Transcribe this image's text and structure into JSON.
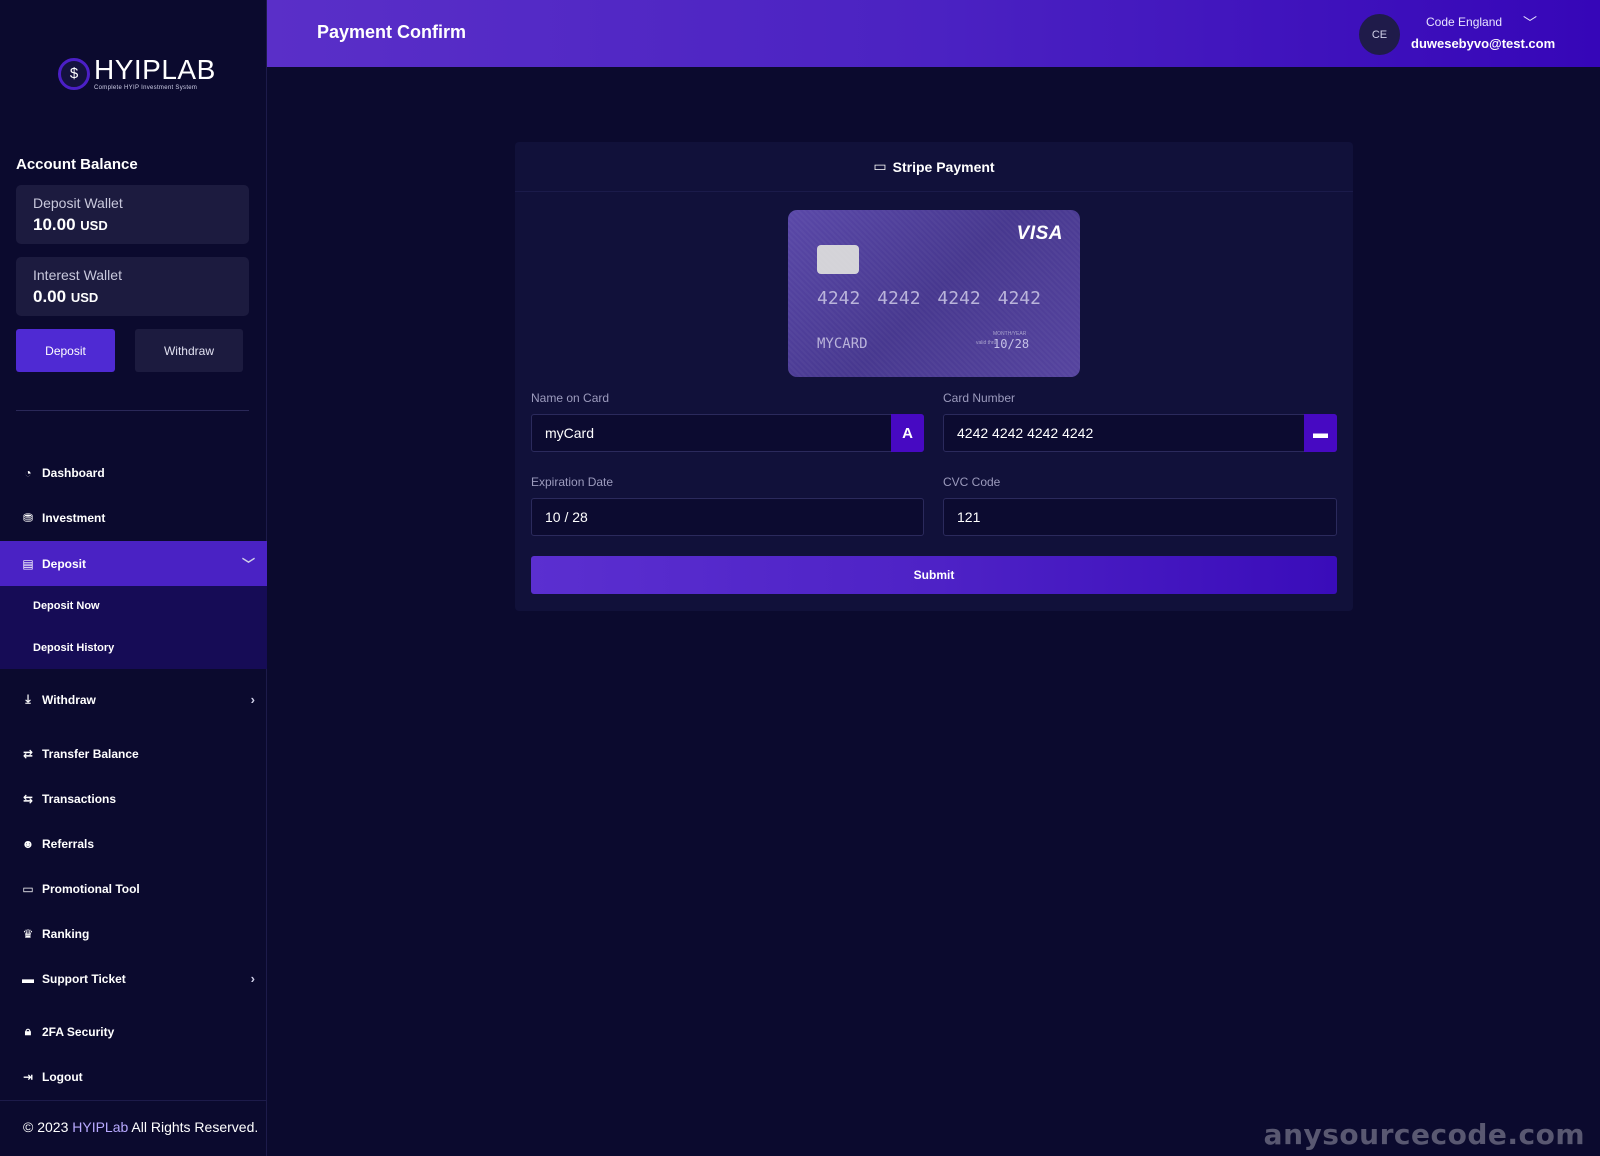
{
  "logo": {
    "icon": "money-bag-icon",
    "name_part1": "HYIP",
    "name_part2": "LAB",
    "tagline": "Complete HYIP Investment System"
  },
  "account": {
    "title": "Account Balance",
    "wallets": [
      {
        "name": "Deposit Wallet",
        "amount": "10.00",
        "currency": "USD"
      },
      {
        "name": "Interest Wallet",
        "amount": "0.00",
        "currency": "USD"
      }
    ],
    "deposit_label": "Deposit",
    "withdraw_label": "Withdraw"
  },
  "nav": {
    "items": [
      {
        "label": "Dashboard",
        "icon": "gauge-icon"
      },
      {
        "label": "Investment",
        "icon": "invest-icon"
      },
      {
        "label": "Deposit",
        "icon": "wallet-icon"
      },
      {
        "label": "Withdraw",
        "icon": "hand-money-icon"
      },
      {
        "label": "Transfer Balance",
        "icon": "handshake-icon"
      },
      {
        "label": "Transactions",
        "icon": "exchange-icon"
      },
      {
        "label": "Referrals",
        "icon": "users-icon"
      },
      {
        "label": "Promotional Tool",
        "icon": "ad-icon"
      },
      {
        "label": "Ranking",
        "icon": "crown-icon"
      },
      {
        "label": "Support Ticket",
        "icon": "ticket-icon"
      },
      {
        "label": "2FA Security",
        "icon": "lock-icon"
      },
      {
        "label": "Logout",
        "icon": "logout-icon"
      }
    ],
    "deposit_sub": [
      "Deposit Now",
      "Deposit History"
    ]
  },
  "footer": {
    "prefix": "© 2023 ",
    "brand": "HYIPLab",
    "suffix": " All Rights Reserved."
  },
  "header": {
    "title": "Payment Confirm",
    "avatar_initials": "CE",
    "user_name": "Code England",
    "user_email": "duwesebyvo@test.com"
  },
  "payment": {
    "title": "Stripe Payment",
    "card_preview": {
      "brand": "VISA",
      "number_groups": [
        "4242",
        "4242",
        "4242",
        "4242"
      ],
      "name": "MYCARD",
      "expiry_label": "MONTH/YEAR",
      "valid_label": "valid thru",
      "expiry": "10/28"
    },
    "fields": {
      "name_label": "Name on Card",
      "name_value": "myCard",
      "number_label": "Card Number",
      "number_value": "4242 4242 4242 4242",
      "expiry_label": "Expiration Date",
      "expiry_value": "10 / 28",
      "cvc_label": "CVC Code",
      "cvc_value": "121"
    },
    "submit_label": "Submit"
  },
  "watermark": "anysourcecode.com",
  "colors": {
    "background": "#0b0a2e",
    "accent": "#4a22c4",
    "card": "#11113a"
  }
}
